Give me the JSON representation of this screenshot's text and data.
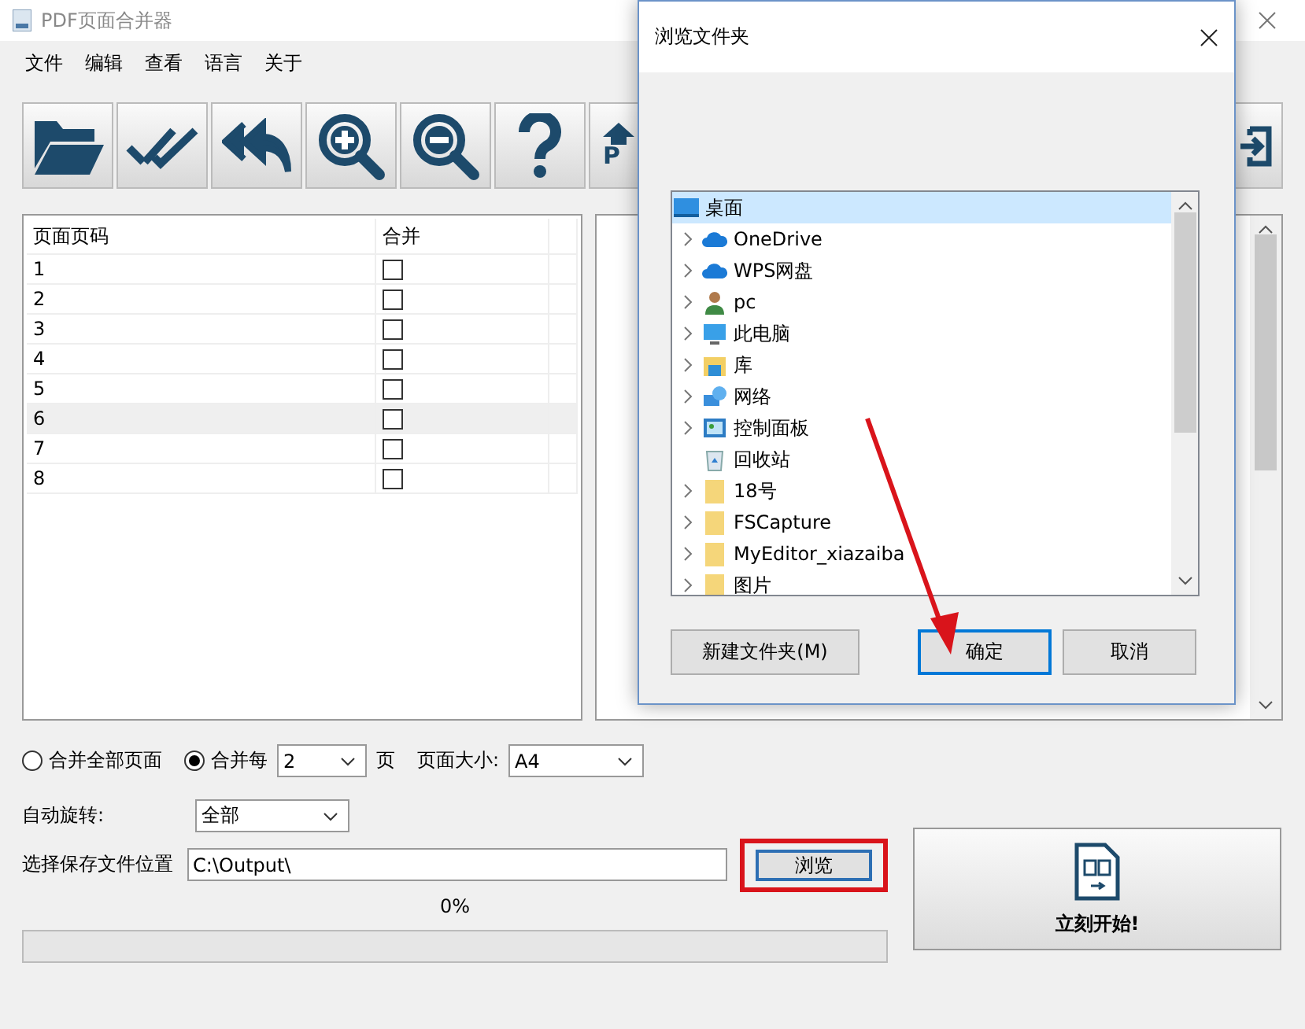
{
  "window": {
    "title": "PDF页面合并器"
  },
  "menu": [
    "文件",
    "编辑",
    "查看",
    "语言",
    "关于"
  ],
  "toolbar": [
    {
      "kind": "open"
    },
    {
      "kind": "check"
    },
    {
      "kind": "undo"
    },
    {
      "kind": "zoom-in"
    },
    {
      "kind": "zoom-out"
    },
    {
      "kind": "help"
    },
    {
      "kind": "upload",
      "label": "P"
    },
    {
      "kind": "exit"
    }
  ],
  "table": {
    "columns": [
      "页面页码",
      "合并"
    ],
    "rows": [
      {
        "page": "1",
        "merge": false,
        "selected": false
      },
      {
        "page": "2",
        "merge": false,
        "selected": false
      },
      {
        "page": "3",
        "merge": false,
        "selected": false
      },
      {
        "page": "4",
        "merge": false,
        "selected": false
      },
      {
        "page": "5",
        "merge": false,
        "selected": false
      },
      {
        "page": "6",
        "merge": false,
        "selected": true
      },
      {
        "page": "7",
        "merge": false,
        "selected": false
      },
      {
        "page": "8",
        "merge": false,
        "selected": false
      }
    ]
  },
  "merge_mode": [
    {
      "label": "合并全部页面",
      "selected": false
    },
    {
      "label": "合并每",
      "selected": true
    }
  ],
  "every_value": "2",
  "every_unit": "页",
  "page_size_label": "页面大小:",
  "page_size": "A4",
  "rotate_label": "自动旋转:",
  "rotate": "全部",
  "save_label": "选择保存文件位置",
  "save_path": "C:\\Output\\",
  "browse_button": "浏览",
  "progress": {
    "text": "0%",
    "level": 0
  },
  "start_button": "立刻开始!",
  "dialog": {
    "title": "浏览文件夹",
    "tree": [
      {
        "label": "桌面",
        "kind": "desktop",
        "selected": true,
        "expandable": false,
        "children": [
          {
            "label": "OneDrive",
            "kind": "cloud",
            "selected": false,
            "expandable": true
          },
          {
            "label": "WPS网盘",
            "kind": "cloud",
            "selected": false,
            "expandable": true
          },
          {
            "label": "pc",
            "kind": "user",
            "selected": false,
            "expandable": true
          },
          {
            "label": "此电脑",
            "kind": "computer",
            "selected": false,
            "expandable": true
          },
          {
            "label": "库",
            "kind": "library",
            "selected": false,
            "expandable": true
          },
          {
            "label": "网络",
            "kind": "network",
            "selected": false,
            "expandable": true
          },
          {
            "label": "控制面板",
            "kind": "control-panel",
            "selected": false,
            "expandable": true
          },
          {
            "label": "回收站",
            "kind": "recycle",
            "selected": false,
            "expandable": false
          },
          {
            "label": "18号",
            "kind": "folder",
            "selected": false,
            "expandable": true
          },
          {
            "label": "FSCapture",
            "kind": "folder",
            "selected": false,
            "expandable": true
          },
          {
            "label": "MyEditor_xiazaiba",
            "kind": "folder",
            "selected": false,
            "expandable": true
          },
          {
            "label": "图片",
            "kind": "folder",
            "selected": false,
            "expandable": true
          }
        ]
      }
    ],
    "buttons": [
      {
        "label": "新建文件夹(M)",
        "default": false
      },
      {
        "label": "确定",
        "default": true
      },
      {
        "label": "取消",
        "default": false
      }
    ]
  }
}
